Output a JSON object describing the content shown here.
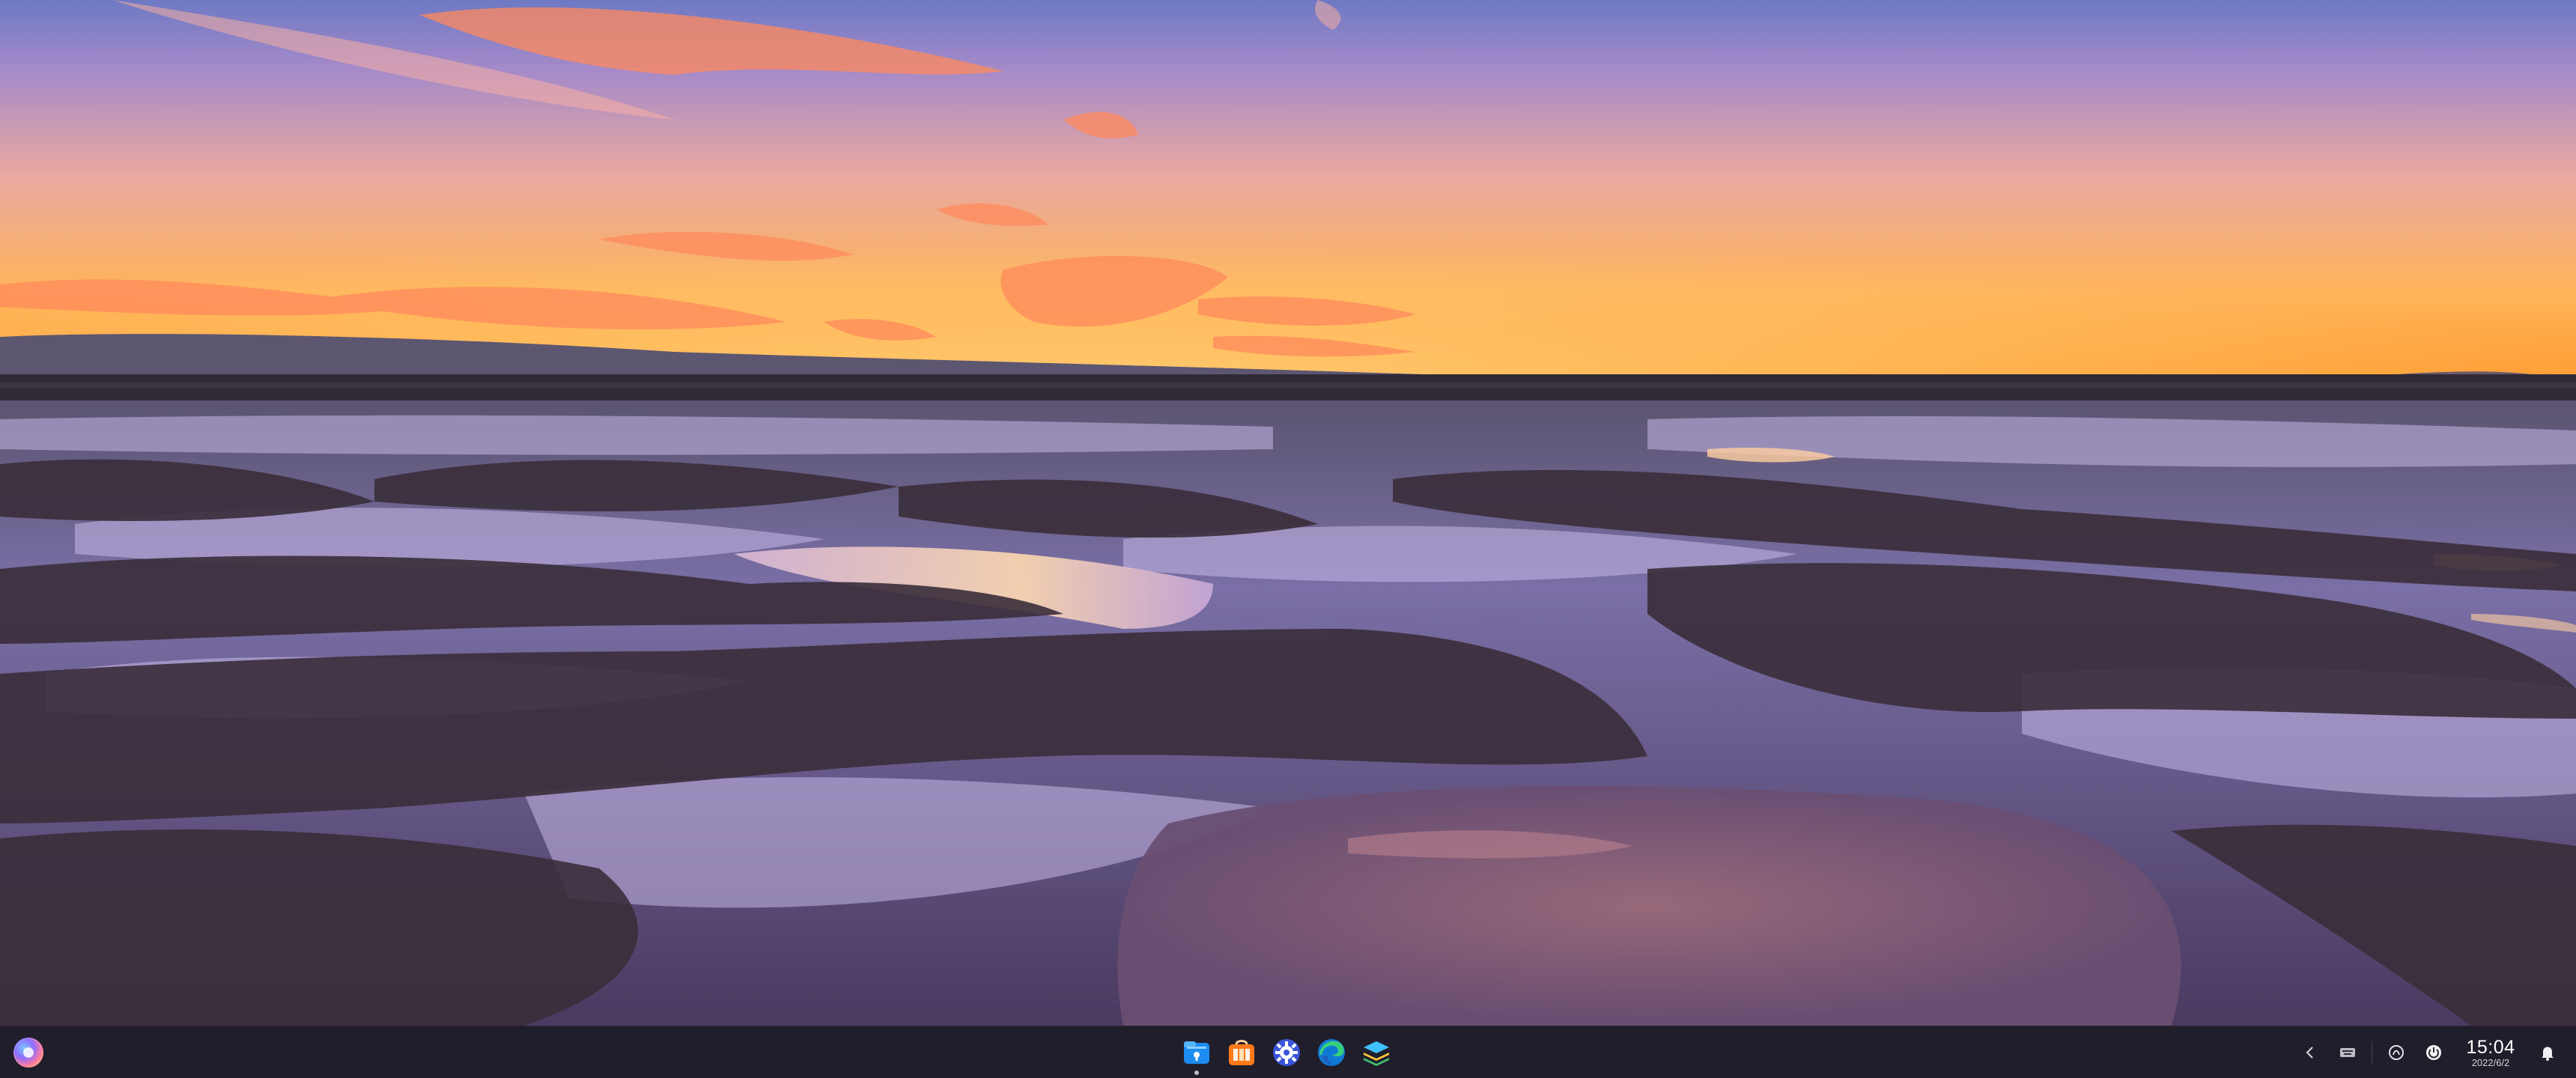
{
  "taskbar": {
    "launcher": {
      "icon": "launcher-icon"
    },
    "dock": [
      {
        "name": "file-manager",
        "icon": "file-manager-icon",
        "running": true
      },
      {
        "name": "app-store",
        "icon": "app-store-icon",
        "running": false
      },
      {
        "name": "settings",
        "icon": "settings-gear-icon",
        "running": false
      },
      {
        "name": "edge-browser",
        "icon": "edge-browser-icon",
        "running": false
      },
      {
        "name": "layers-app",
        "icon": "layers-icon",
        "running": false
      }
    ],
    "tray": {
      "clock_time": "15:04",
      "clock_date": "2022/6/2"
    }
  },
  "colors": {
    "sky_top": "#7b6fb5",
    "horizon": "#ffa64a",
    "ground": "#5a4a7a",
    "taskbar": "#18181e"
  }
}
